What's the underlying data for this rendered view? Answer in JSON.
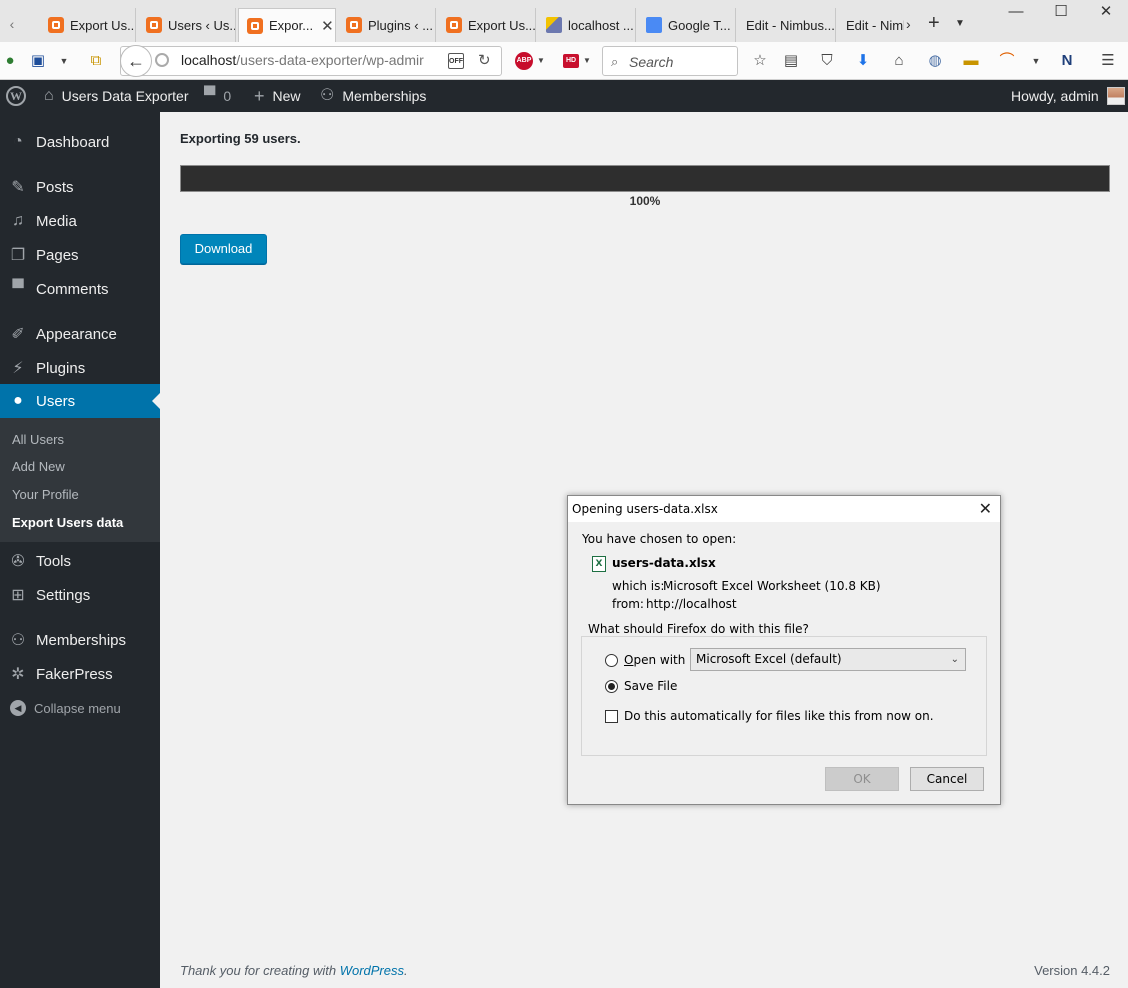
{
  "browser": {
    "tabs": [
      {
        "label": "Export Us...",
        "favicon": "xampp",
        "active": false
      },
      {
        "label": "Users ‹ Us...",
        "favicon": "xampp",
        "active": false
      },
      {
        "label": "Expor...",
        "favicon": "xampp",
        "active": true
      },
      {
        "label": "Plugins ‹ ...",
        "favicon": "xampp",
        "active": false
      },
      {
        "label": "Export Us...",
        "favicon": "xampp",
        "active": false
      },
      {
        "label": "localhost ...",
        "favicon": "phpmyadmin",
        "active": false
      },
      {
        "label": "Google T...",
        "favicon": "google-translate",
        "active": false
      },
      {
        "label": "Edit - Nimbus...",
        "favicon": "none",
        "active": false
      },
      {
        "label": "Edit - Nimb",
        "favicon": "none",
        "active": false
      }
    ],
    "url_host": "localhost",
    "url_path": "/users-data-exporter/wp-admir",
    "search_placeholder": "Search"
  },
  "adminbar": {
    "site_name": "Users Data Exporter",
    "comments_count": "0",
    "new_label": "New",
    "memberships_label": "Memberships",
    "greeting": "Howdy, admin"
  },
  "sidebar": {
    "items": [
      {
        "label": "Dashboard",
        "icon": "dashboard-icon"
      },
      {
        "label": "Posts",
        "icon": "pin-icon"
      },
      {
        "label": "Media",
        "icon": "media-icon"
      },
      {
        "label": "Pages",
        "icon": "pages-icon"
      },
      {
        "label": "Comments",
        "icon": "comment-icon"
      },
      {
        "label": "Appearance",
        "icon": "brush-icon"
      },
      {
        "label": "Plugins",
        "icon": "plug-icon"
      },
      {
        "label": "Users",
        "icon": "user-icon"
      },
      {
        "label": "Tools",
        "icon": "wrench-icon"
      },
      {
        "label": "Settings",
        "icon": "settings-icon"
      },
      {
        "label": "Memberships",
        "icon": "groups-icon"
      },
      {
        "label": "FakerPress",
        "icon": "accessibility-icon"
      }
    ],
    "submenu": [
      {
        "label": "All Users"
      },
      {
        "label": "Add New"
      },
      {
        "label": "Your Profile"
      },
      {
        "label": "Export Users data"
      }
    ],
    "collapse_label": "Collapse menu"
  },
  "main": {
    "status_text": "Exporting 59 users.",
    "progress_percent": 100,
    "progress_label": "100%",
    "download_label": "Download",
    "footer_text": "Thank you for creating with ",
    "footer_link": "WordPress",
    "footer_period": ".",
    "version": "Version 4.4.2"
  },
  "dialog": {
    "title": "Opening users-data.xlsx",
    "intro": "You have chosen to open:",
    "filename": "users-data.xlsx",
    "which_is_label": "which is:",
    "which_is_value": "Microsoft Excel Worksheet (10.8 KB)",
    "from_label": "from:",
    "from_value": "http://localhost",
    "question": "What should Firefox do with this file?",
    "open_with_label": "Open with",
    "open_with_app": "Microsoft Excel (default)",
    "save_file_label": "Save File",
    "auto_label": "Do this automatically for files like this from now on.",
    "ok_label": "OK",
    "cancel_label": "Cancel",
    "selected_option": "save-file"
  },
  "colors": {
    "admin_bar": "#23282d",
    "sidebar_bg": "#23282d",
    "submenu_bg": "#32373c",
    "current_menu": "#0073aa",
    "button_primary": "#0085ba",
    "progress_fill": "#2e2e2e"
  }
}
